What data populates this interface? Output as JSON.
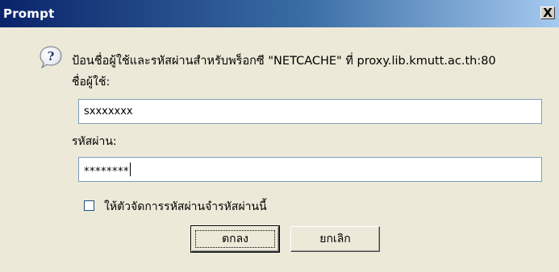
{
  "window": {
    "title": "Prompt",
    "close_glyph": "X"
  },
  "dialog": {
    "icon": "question-icon",
    "message": "ป้อนชื่อผู้ใช้และรหัสผ่านสำหรับพร็อกซี \"NETCACHE\" ที่ proxy.lib.kmutt.ac.th:80",
    "username_label": "ชื่อผู้ใช้:",
    "username_value": "sxxxxxxx",
    "password_label": "รหัสผ่าน:",
    "password_value": "********",
    "remember_label": "ให้ตัวจัดการรหัสผ่านจำรหัสผ่านนี้",
    "remember_checked": false,
    "ok_label": "ตกลง",
    "cancel_label": "ยกเลิก"
  },
  "colors": {
    "titlebar_start": "#0a246a",
    "titlebar_end": "#a6caf0",
    "dialog_bg": "#ece9d8",
    "field_border": "#7f9db9"
  }
}
